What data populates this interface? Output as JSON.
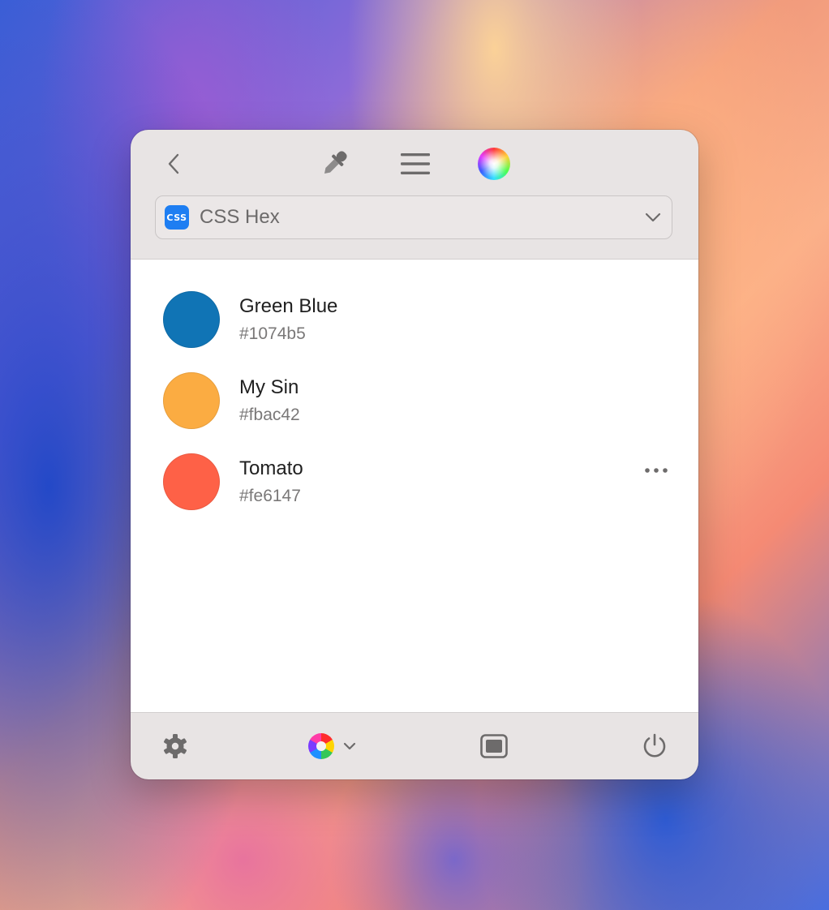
{
  "toolbar": {
    "back_icon": "chevron-left-icon",
    "picker_icon": "eyedropper-icon",
    "menu_icon": "hamburger-menu-icon",
    "color_wheel_icon": "color-wheel-icon"
  },
  "format_select": {
    "badge": "CSS",
    "label": "CSS Hex",
    "chevron_icon": "chevron-down-icon"
  },
  "colors": [
    {
      "name": "Green Blue",
      "hex": "#1074b5",
      "swatch": "#1074b5"
    },
    {
      "name": "My Sin",
      "hex": "#fbac42",
      "swatch": "#fbac42"
    },
    {
      "name": "Tomato",
      "hex": "#fe6147",
      "swatch": "#fe6147"
    }
  ],
  "bottom_bar": {
    "settings_icon": "gear-icon",
    "palette_icon": "color-palette-icon",
    "palette_chevron_icon": "chevron-down-icon",
    "window_icon": "window-icon",
    "power_icon": "power-icon"
  },
  "colors_theme": {
    "panel_bg": "#e8e4e4",
    "icon_gray": "#6d6b6b",
    "badge_blue": "#1e7ef2"
  }
}
